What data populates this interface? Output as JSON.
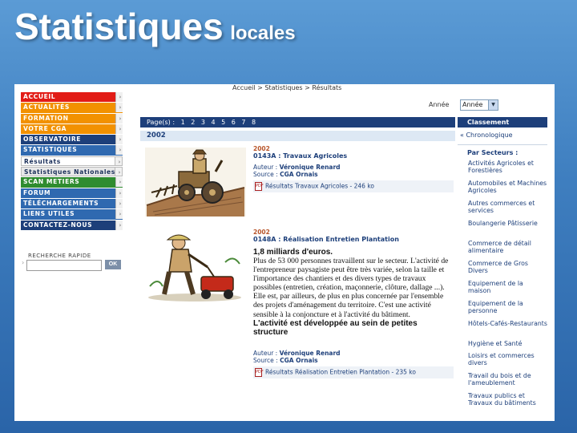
{
  "slide": {
    "title": "Statistiques",
    "subtitle": "locales"
  },
  "breadcrumb": "Accueil > Statistiques > Résultats",
  "nav": {
    "items": [
      {
        "label": "ACCUEIL",
        "color": "red"
      },
      {
        "label": "ACTUALITÉS",
        "color": "orange"
      },
      {
        "label": "FORMATION",
        "color": "orange"
      },
      {
        "label": "VOTRE CGA",
        "color": "orange"
      },
      {
        "label": "OBSERVATOIRE",
        "color": "navy"
      },
      {
        "label": "STATISTIQUES",
        "color": "blue"
      },
      {
        "label": "Résultats",
        "color": "white"
      },
      {
        "label": "Statistiques Nationales",
        "color": "gray"
      },
      {
        "label": "SCAN METIERS",
        "color": "green"
      },
      {
        "label": "FORUM",
        "color": "blue"
      },
      {
        "label": "TÉLÉCHARGEMENTS",
        "color": "blue"
      },
      {
        "label": "LIENS UTILES",
        "color": "blue"
      },
      {
        "label": "CONTACTEZ-NOUS",
        "color": "navy"
      }
    ],
    "search_label": "RECHERCHE RAPIDE",
    "search_value": "",
    "ok_label": "OK"
  },
  "year_filter": {
    "label": "Année",
    "selected": "Année"
  },
  "pages": {
    "label": "Page(s) :",
    "numbers": [
      "1",
      "2",
      "3",
      "4",
      "5",
      "6",
      "7",
      "8"
    ]
  },
  "year_header": "2002",
  "articles": [
    {
      "year": "2002",
      "title": "0143A : Travaux Agricoles",
      "author_label": "Auteur :",
      "author": "Véronique Renard",
      "source_label": "Source :",
      "source": "CGA Ornais",
      "link": "Résultats Travaux Agricoles - 246 ko"
    },
    {
      "year": "2002",
      "title": "0148A : Réalisation Entretien Plantation",
      "headline": "1,8 milliards d'euros.",
      "body": "Plus de 53 000 personnes travaillent sur le secteur. L'activité de l'entrepreneur paysagiste peut être très variée, selon la taille et l'importance des chantiers et des divers types de travaux possibles (entretien, création, maçonnerie, clôture, dallage ...). Elle est, par ailleurs, de plus en plus concernée par l'ensemble des projets d'aménagement du territoire. C'est une activité sensible à la conjoncture et à l'activité du bâtiment.",
      "conclusion": "L'activité est développée au sein de petites structure",
      "author_label": "Auteur :",
      "author": "Véronique Renard",
      "source_label": "Source :",
      "source": "CGA Ornais",
      "link": "Résultats Réalisation Entretien Plantation - 235 ko"
    }
  ],
  "sidebar": {
    "header": "Classement",
    "chrono": "Chronologique",
    "by_sector": "Par Secteurs :",
    "sectors": [
      "Activités Agricoles et Forestières",
      "Automobiles et Machines Agricoles",
      "Autres commerces et services",
      "Boulangerie Pâtisserie",
      "Commerce de détail alimentaire",
      "Commerce de Gros Divers",
      "Equipement de la maison",
      "Equipement de la personne",
      "Hôtels-Cafés-Restaurants",
      "Hygiène et Santé",
      "Loisirs et commerces divers",
      "Travail du bois et de l'ameublement",
      "Travaux publics et Travaux du bâtiments"
    ]
  },
  "colors": {
    "slide_bg": "#3f7fc0",
    "navy": "#1d3f7a",
    "red": "#e21c16",
    "orange": "#f29100",
    "green": "#2f8c2f",
    "year_accent": "#b8552a"
  }
}
